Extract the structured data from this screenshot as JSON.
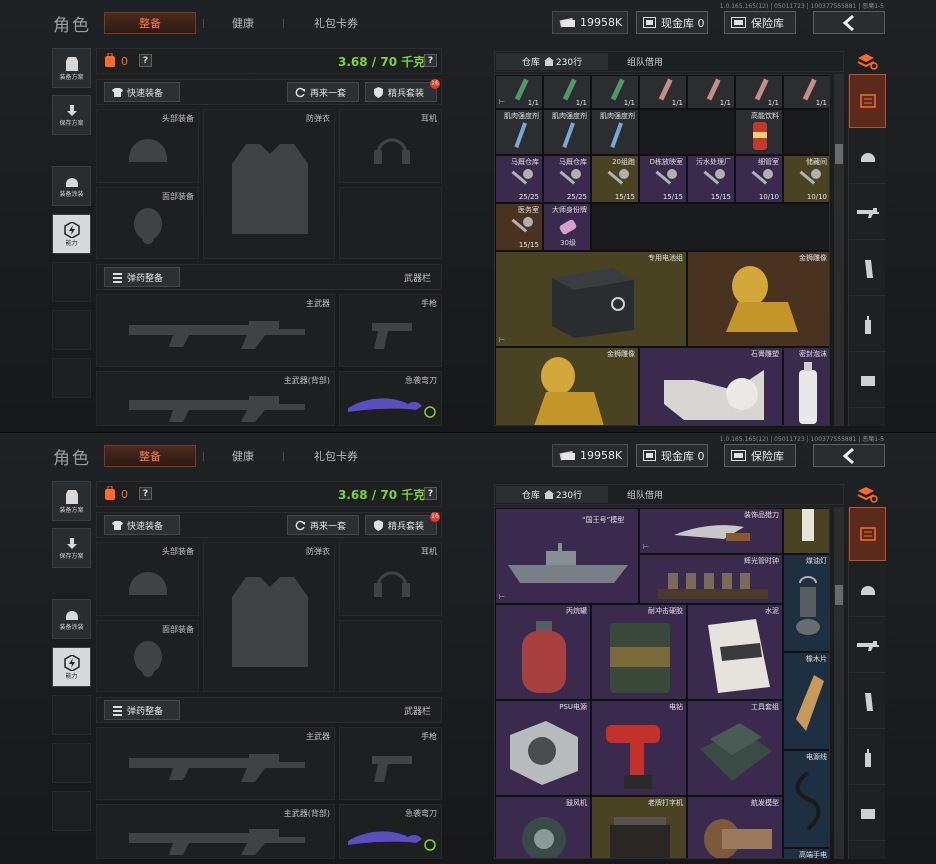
{
  "version": "1.0.165.165(12) | 05011723 | 100377555881 | 恶魔1-5",
  "header": {
    "title": "角色",
    "tabs": [
      {
        "label": "整备",
        "active": true
      },
      {
        "label": "健康",
        "active": false
      },
      {
        "label": "礼包卡券",
        "active": false
      }
    ],
    "currency": "19958K",
    "cash_vault": "现金库 0",
    "vault": "保险库"
  },
  "side_buttons": [
    {
      "label": "装备方案",
      "icon": "vest-icon"
    },
    {
      "label": "保存方案",
      "icon": "download-icon"
    },
    {
      "label": "装备涂装",
      "icon": "helmet-icon"
    },
    {
      "label": "能力",
      "icon": "lightning-icon"
    }
  ],
  "loadout": {
    "backpack_count": "0",
    "help": "?",
    "weight": "3.68 / 70 千克",
    "quick_equip": "快速装备",
    "again": "再来一套",
    "elite": "精兵套装",
    "elite_badge": "16",
    "slots": {
      "helmet": "头部装备",
      "armor": "防弹衣",
      "earphone": "耳机",
      "face": "面部装备",
      "ammo": "弹药整备",
      "weapon_bar": "武器栏",
      "primary": "主武器",
      "pistol": "手枪",
      "primary_back": "主武器(背部)",
      "melee": "急袭弯刀"
    }
  },
  "storage": {
    "tab_warehouse": "仓库",
    "tab_count": "230行",
    "tab_team": "组队借用",
    "view1": {
      "injectors": [
        {
          "qty": "1/1"
        },
        {
          "qty": "1/1"
        },
        {
          "qty": "1/1"
        },
        {
          "qty": "1/1"
        },
        {
          "qty": "1/1"
        },
        {
          "qty": "1/1"
        },
        {
          "qty": "1/1"
        }
      ],
      "muscle": [
        {
          "name": "肌肉强度剂"
        },
        {
          "name": "肌肉强度剂"
        },
        {
          "name": "肌肉强度剂"
        }
      ],
      "drink": "高能饮料",
      "keys": [
        {
          "name": "马厩仓库",
          "qty": "25/25"
        },
        {
          "name": "马厩仓库",
          "qty": "25/25"
        },
        {
          "name": "20组跑",
          "qty": "15/15"
        },
        {
          "name": "D栋放映室",
          "qty": "15/15"
        },
        {
          "name": "污水处理厂",
          "qty": "15/15"
        },
        {
          "name": "细管室",
          "qty": "10/10"
        },
        {
          "name": "储藏间",
          "qty": "10/10"
        }
      ],
      "key_med": {
        "name": "医务室",
        "qty": "15/15"
      },
      "badge": {
        "name": "大师身份牌",
        "qty": "30级"
      },
      "battery": "专用电池组",
      "lion1": "金狮雕像",
      "lion2": "金狮雕像",
      "plaster": "石膏雕塑",
      "foam": "密封泡沫"
    },
    "view2": {
      "ship": "“国王号”模型",
      "blade": "装饰品猎刀",
      "clock": "辉光管时钟",
      "lamp": "煤油灯",
      "gas": "丙烷罐",
      "glue": "耐冲击硬胶",
      "cement": "水泥",
      "wood": "橡木片",
      "psu": "PSU电源",
      "drill": "电钻",
      "toolbox": "工具套组",
      "cable": "电源线",
      "fan": "鼓风机",
      "typewriter": "老牌打字机",
      "engine": "航发模型",
      "last": "高端手电"
    }
  },
  "colors": {
    "accent": "#ff6a2c",
    "green": "#7dd33a",
    "purple": "#3a2a4d",
    "gold": "#4a4322",
    "blue": "#1e2f42"
  }
}
